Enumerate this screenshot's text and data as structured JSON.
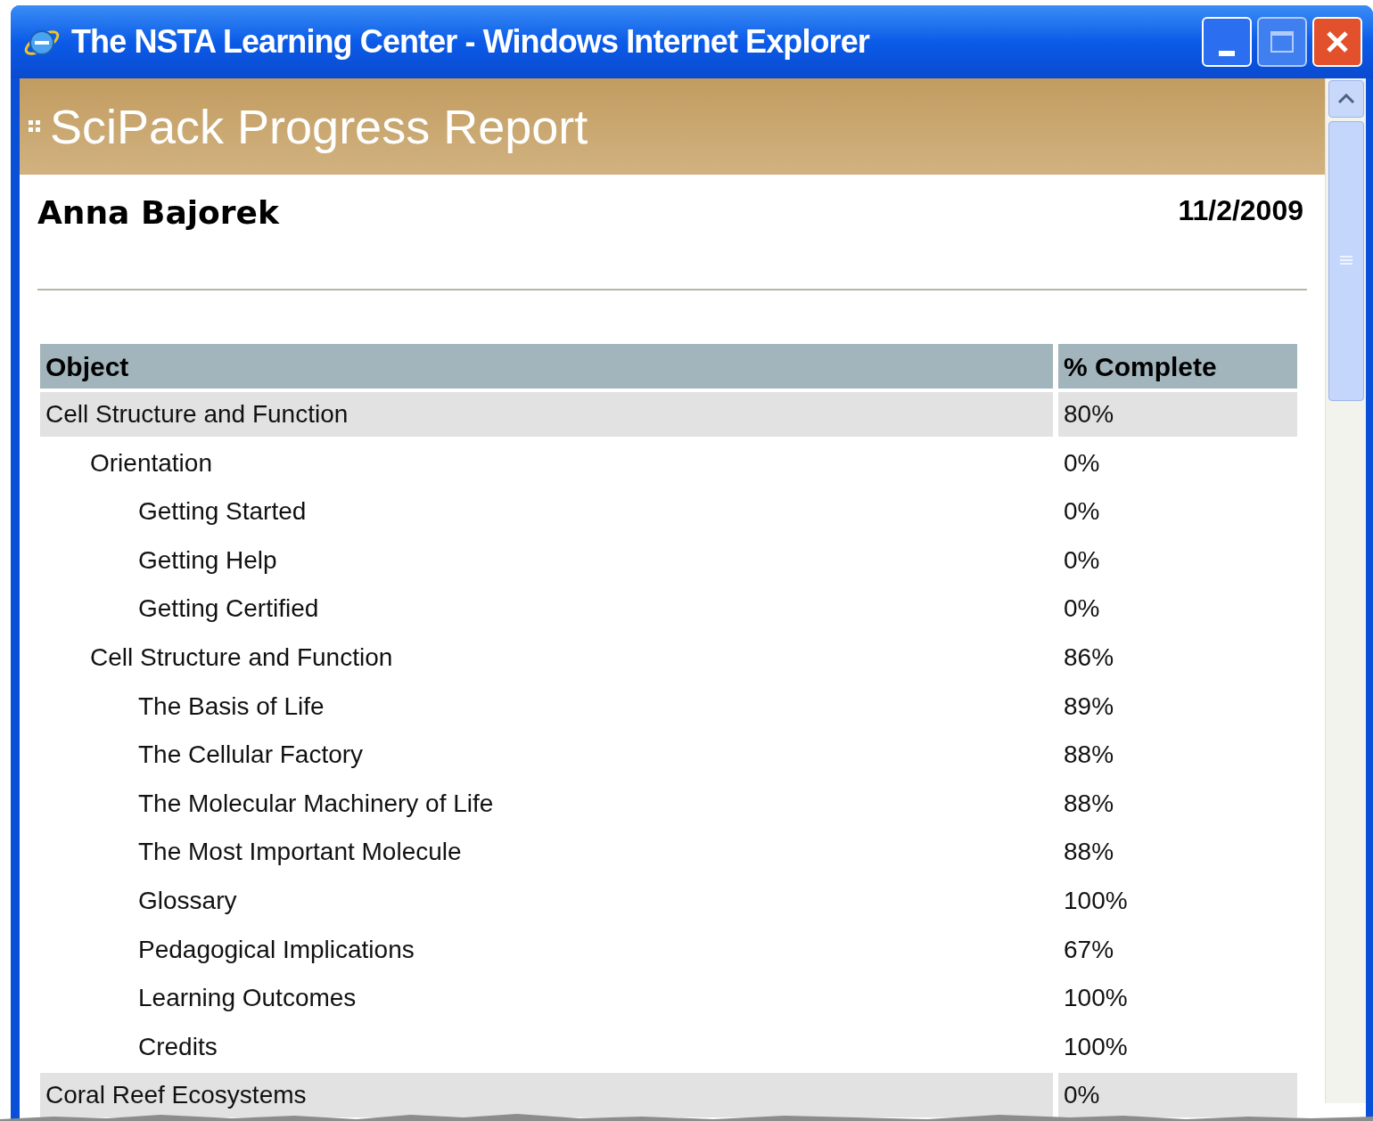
{
  "window": {
    "title": "The NSTA Learning Center - Windows Internet Explorer"
  },
  "header": {
    "title": "SciPack Progress Report"
  },
  "student": {
    "name": "Anna Bajorek",
    "date": "11/2/2009"
  },
  "table": {
    "columns": [
      "Object",
      "% Complete"
    ],
    "rows": [
      {
        "label": "Cell Structure and Function",
        "value": "80%",
        "children": [
          {
            "label": "Orientation",
            "value": "0%",
            "children": [
              {
                "label": "Getting Started",
                "value": "0%"
              },
              {
                "label": "Getting Help",
                "value": "0%"
              },
              {
                "label": "Getting Certified",
                "value": "0%"
              }
            ]
          },
          {
            "label": "Cell Structure and Function",
            "value": "86%",
            "children": [
              {
                "label": "The Basis of Life",
                "value": "89%"
              },
              {
                "label": "The Cellular Factory",
                "value": "88%"
              },
              {
                "label": "The Molecular Machinery of Life",
                "value": "88%"
              },
              {
                "label": "The Most Important Molecule",
                "value": "88%"
              },
              {
                "label": "Glossary",
                "value": "100%"
              },
              {
                "label": "Pedagogical Implications",
                "value": "67%"
              },
              {
                "label": "Learning Outcomes",
                "value": "100%"
              },
              {
                "label": "Credits",
                "value": "100%"
              }
            ]
          }
        ]
      },
      {
        "label": "Coral Reef Ecosystems",
        "value": "0%"
      }
    ]
  }
}
